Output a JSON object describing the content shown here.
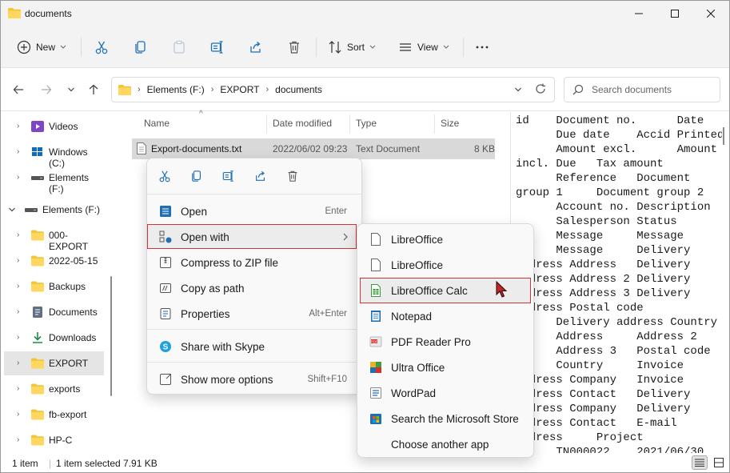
{
  "window": {
    "title": "documents",
    "minimize_icon": "minimize-icon",
    "maximize_icon": "maximize-icon",
    "close_icon": "close-icon"
  },
  "toolbar": {
    "new_label": "New",
    "sort_label": "Sort",
    "view_label": "View",
    "icons": [
      "plus-icon",
      "cut-icon",
      "copy-icon",
      "paste-icon",
      "rename-icon",
      "share-icon",
      "delete-icon",
      "more-icon"
    ]
  },
  "address": {
    "crumbs": [
      "Elements (F:)",
      "EXPORT",
      "documents"
    ],
    "search_placeholder": "Search documents"
  },
  "sidebar": {
    "items": [
      {
        "label": "Videos",
        "icon": "videos-icon"
      },
      {
        "label": "Windows (C:)",
        "icon": "windows-drive-icon"
      },
      {
        "label": "Elements (F:)",
        "icon": "drive-icon"
      },
      {
        "label": "Elements (F:)",
        "icon": "drive-icon"
      },
      {
        "label": "000-EXPORT",
        "icon": "folder-icon"
      },
      {
        "label": "2022-05-15",
        "icon": "folder-icon"
      },
      {
        "label": "Backups",
        "icon": "folder-icon"
      },
      {
        "label": "Documents",
        "icon": "documents-icon"
      },
      {
        "label": "Downloads",
        "icon": "downloads-icon"
      },
      {
        "label": "EXPORT",
        "icon": "folder-icon"
      },
      {
        "label": "exports",
        "icon": "folder-icon"
      },
      {
        "label": "fb-export",
        "icon": "folder-icon"
      },
      {
        "label": "HP-C",
        "icon": "folder-icon"
      }
    ]
  },
  "filelist": {
    "columns": [
      "Name",
      "Date modified",
      "Type",
      "Size"
    ],
    "rows": [
      {
        "name": "Export-documents.txt",
        "date": "2022/06/02 09:23",
        "type": "Text Document",
        "size": "8 KB"
      }
    ]
  },
  "preview": {
    "text": "id    Document no.      Date\n      Due date    Accid Printed\n      Amount excl.      Amount\nincl. Due   Tax amount\n      Reference   Document\ngroup 1     Document group 2\n      Account no. Description\n      Salesperson Status\n      Message     Message\n      Message     Delivery\naddress Address   Delivery\naddress Address 2 Delivery\naddress Address 3 Delivery\naddress Postal code\n      Delivery address Country\n      Address     Address 2\n      Address 3   Postal code\n      Country     Invoice\naddress Company   Invoice\naddress Contact   Delivery\naddress Company   Delivery\naddress Contact   E-mail\naddress     Project\n      TN000022    2021/06/30"
  },
  "status": {
    "count": "1 item",
    "selected": "1 item selected  7.91 KB"
  },
  "context_menu": {
    "quick_icons": [
      "cut-icon",
      "copy-icon",
      "rename-icon",
      "share-icon",
      "delete-icon"
    ],
    "items": [
      {
        "label": "Open",
        "shortcut": "Enter",
        "icon": "open-icon"
      },
      {
        "label": "Open with",
        "shortcut": "",
        "icon": "open-with-icon"
      },
      {
        "label": "Compress to ZIP file",
        "shortcut": "",
        "icon": "zip-icon"
      },
      {
        "label": "Copy as path",
        "shortcut": "",
        "icon": "copy-path-icon"
      },
      {
        "label": "Properties",
        "shortcut": "Alt+Enter",
        "icon": "properties-icon"
      },
      {
        "label": "Share with Skype",
        "shortcut": "",
        "icon": "skype-icon"
      },
      {
        "label": "Show more options",
        "shortcut": "Shift+F10",
        "icon": "more-options-icon"
      }
    ]
  },
  "open_with_menu": {
    "items": [
      {
        "label": "LibreOffice",
        "icon": "libreoffice-icon"
      },
      {
        "label": "LibreOffice",
        "icon": "libreoffice-icon"
      },
      {
        "label": "LibreOffice Calc",
        "icon": "libreoffice-calc-icon"
      },
      {
        "label": "Notepad",
        "icon": "notepad-icon"
      },
      {
        "label": "PDF Reader Pro",
        "icon": "pdf-reader-icon"
      },
      {
        "label": "Ultra Office",
        "icon": "ultra-office-icon"
      },
      {
        "label": "WordPad",
        "icon": "wordpad-icon"
      },
      {
        "label": "Search the Microsoft Store",
        "icon": "store-icon"
      },
      {
        "label": "Choose another app",
        "icon": ""
      }
    ]
  },
  "colors": {
    "highlight_border": "#d13438",
    "folder": "#f4c43b",
    "accent": "#0067c0"
  }
}
